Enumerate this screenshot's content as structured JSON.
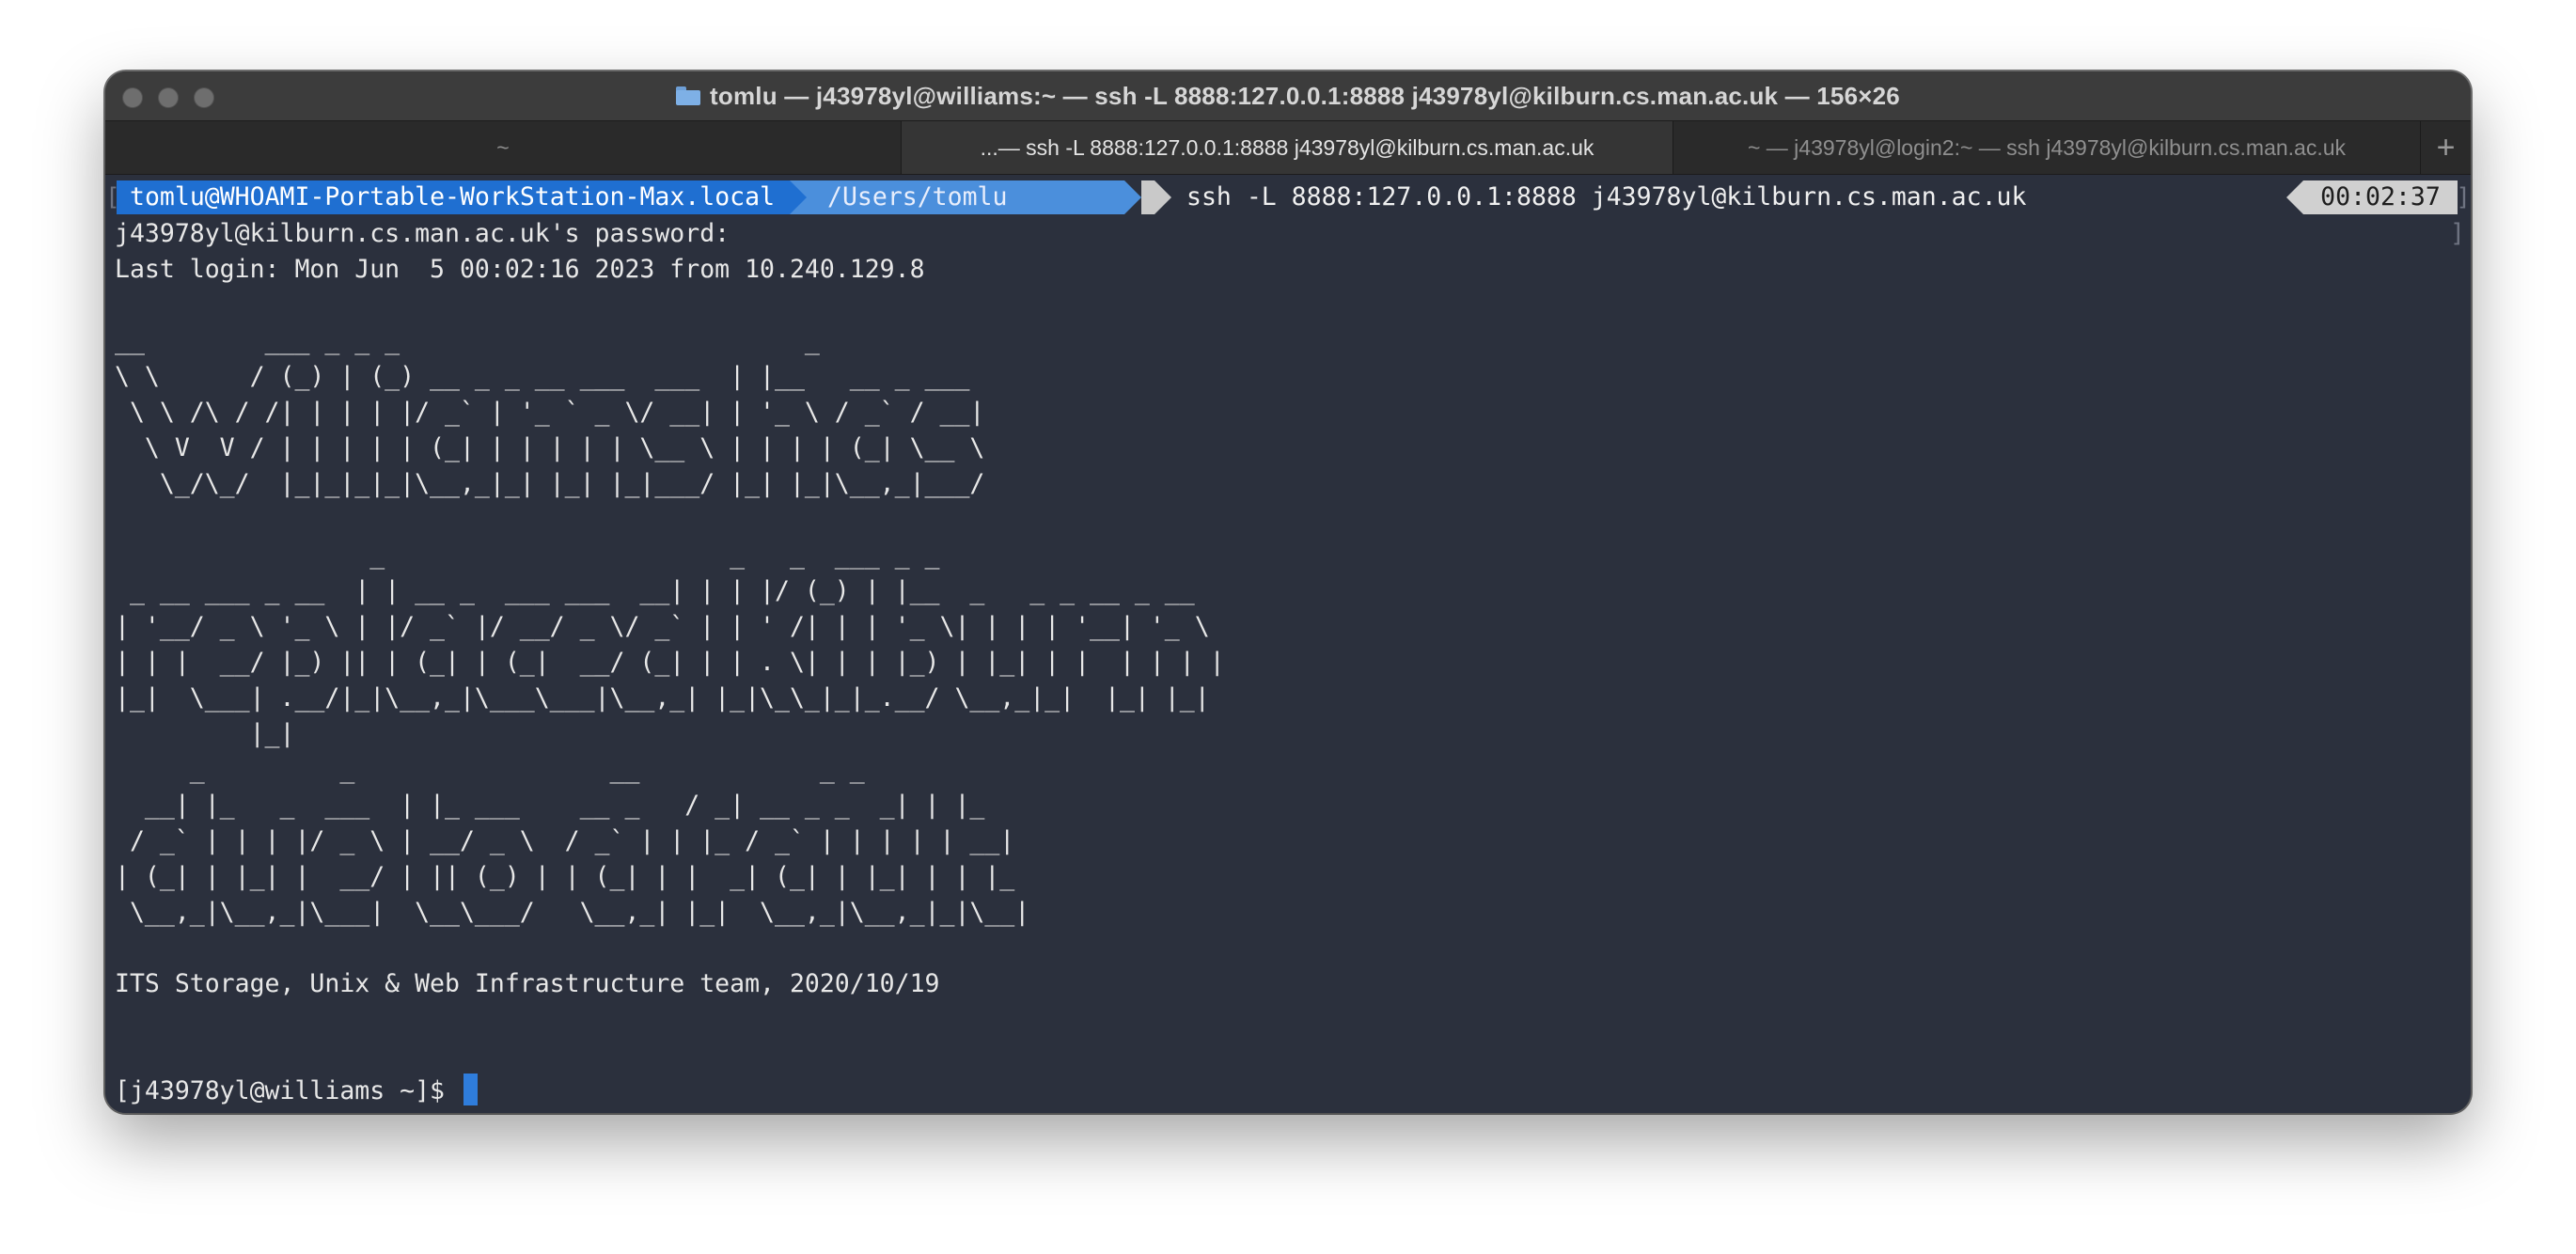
{
  "window": {
    "title": "tomlu — j43978yl@williams:~ — ssh -L 8888:127.0.0.1:8888 j43978yl@kilburn.cs.man.ac.uk — 156×26"
  },
  "tabs": [
    {
      "label": "~",
      "active": false
    },
    {
      "label": "...— ssh -L 8888:127.0.0.1:8888 j43978yl@kilburn.cs.man.ac.uk",
      "active": true
    },
    {
      "label": "~ — j43978yl@login2:~ — ssh j43978yl@kilburn.cs.man.ac.uk",
      "active": false
    }
  ],
  "add_tab_label": "+",
  "prompt": {
    "host": "tomlu@WHOAMI-Portable-WorkStation-Max.local",
    "dir": "/Users/tomlu",
    "command": "ssh -L 8888:127.0.0.1:8888 j43978yl@kilburn.cs.man.ac.uk",
    "time": "00:02:37"
  },
  "output": {
    "password_prompt": "j43978yl@kilburn.cs.man.ac.uk's password:",
    "last_login": "Last login: Mon Jun  5 00:02:16 2023 from 10.240.129.8",
    "banner_williams": "__        ___ _ _ _                           _\n\\ \\      / (_) | (_) __ _ _ __ ___  ___  | |__   __ _ ___\n \\ \\ /\\ / /| | | | |/ _` | '_ ` _ \\/ __| | '_ \\ / _` / __|\n  \\ V  V / | | | | | (_| | | | | | \\__ \\ | | | | (_| \\__ \\\n   \\_/\\_/  |_|_|_|_|\\__,_|_| |_| |_|___/ |_| |_|\\__,_|___/",
    "banner_replaced": "                 _                       _   _  ___ _ _\n _ __ ___ _ __  | | __ _  ___ ___  __| | | |/ (_) | |__  _   _ _ __ _ __\n| '__/ _ \\ '_ \\ | |/ _` |/ __/ _ \\/ _` | | ' /| | | '_ \\| | | | '__| '_ \\\n| | |  __/ |_) || | (_| | (_|  __/ (_| | | . \\| | | |_) | |_| | |  | | | |\n|_|  \\___| .__/|_|\\__,_|\\___\\___|\\__,_| |_|\\_\\_|_|_.__/ \\__,_|_|  |_| |_|\n         |_|",
    "banner_date": "     _         _                 __            _ _\n  __| |_   _  ___  | |_ ___    __ _   / _| __ _ _  _| | |_\n / _` | | | |/ _ \\ | __/ _ \\  / _` | | |_ / _` | | | | | __|\n| (_| | |_| |  __/ | || (_) | | (_| | |  _| (_| | |_| | | |_\n \\__,_|\\__,_|\\___|  \\__\\___/   \\__,_| |_|  \\__,_|\\__,_|_|\\__|",
    "team_line": "ITS Storage, Unix & Web Infrastructure team, 2020/10/19",
    "shell_prompt": "[j43978yl@williams ~]$ "
  },
  "colors": {
    "terminal_bg": "#2b303d",
    "host_segment": "#1f6fd1",
    "dir_segment": "#4b8fdc",
    "time_segment": "#d0d0d0",
    "cursor": "#2f7ddc"
  },
  "icons": {
    "title": "folder-icon"
  }
}
